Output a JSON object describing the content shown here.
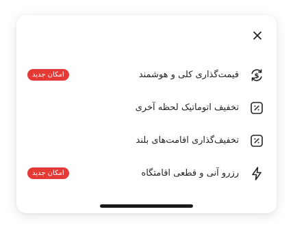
{
  "colors": {
    "badge_bg": "#e53935",
    "text": "#222222",
    "icon": "#222222"
  },
  "close": {
    "icon": "close-icon"
  },
  "menu": {
    "items": [
      {
        "label": "قیمت‌گذاری کلی و هوشمند",
        "icon": "price-refresh-icon",
        "badge": "امکان جدید"
      },
      {
        "label": "تخفیف اتوماتیک لحظه آخری",
        "icon": "percent-discount-icon"
      },
      {
        "label": "تخفیف‌گذاری اقامت‌های بلند",
        "icon": "percent-discount-icon"
      },
      {
        "label": "رزرو آنی و قطعی اقامتگاه",
        "icon": "lightning-icon",
        "badge": "امکان جدید"
      }
    ]
  }
}
